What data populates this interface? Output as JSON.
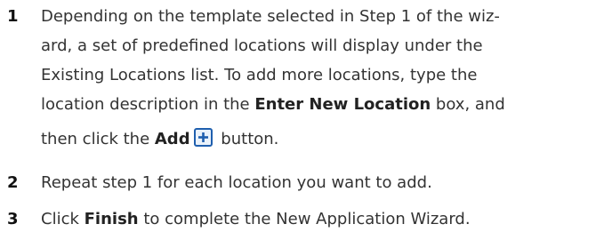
{
  "steps": [
    {
      "number": "1",
      "lines": [
        "Depending on the template selected in Step 1 of the wiz-",
        "ard, a set of predefined locations will display under the",
        "Existing Locations list. To add more locations, type the"
      ],
      "line4_pre": "location description in the ",
      "line4_bold": "Enter New Location",
      "line4_post": " box, and",
      "line5_pre": "then click the ",
      "line5_bold": "Add",
      "line5_post": " button."
    },
    {
      "number": "2",
      "text": "Repeat step 1 for each location you want to add."
    },
    {
      "number": "3",
      "pre": "Click ",
      "bold": "Finish",
      "post": " to complete the New Application Wizard."
    }
  ],
  "icons": {
    "add": "plus-icon",
    "accent": "#1f5fae"
  }
}
